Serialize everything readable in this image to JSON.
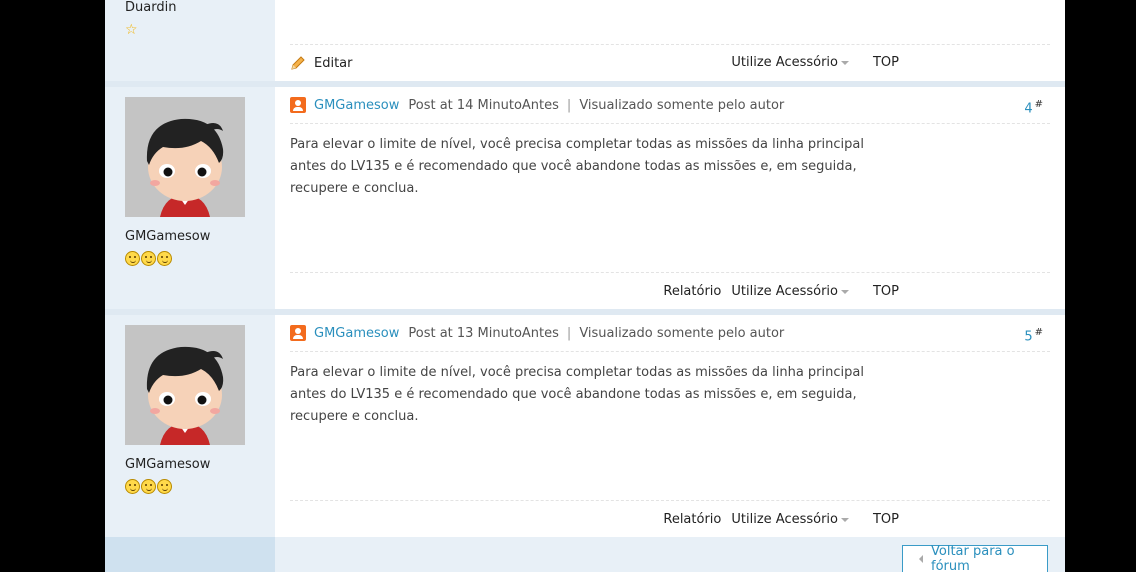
{
  "post_prev": {
    "username": "Duardin",
    "edit_label": "Editar",
    "utilize_label": "Utilize Acessório",
    "top_label": "TOP"
  },
  "posts": [
    {
      "username": "GMGamesow",
      "author": "GMGamesow",
      "posted": "Post at 14 MinutoAntes",
      "view_only_author": "Visualizado somente pelo autor",
      "floor": "4",
      "floor_mark": "#",
      "content": "Para elevar o limite de nível, você precisa completar todas as missões da linha principal antes do LV135 e é recomendado que você abandone todas as missões e, em seguida, recupere e conclua.",
      "report_label": "Relatório",
      "utilize_label": "Utilize Acessório",
      "top_label": "TOP"
    },
    {
      "username": "GMGamesow",
      "author": "GMGamesow",
      "posted": "Post at 13 MinutoAntes",
      "view_only_author": "Visualizado somente pelo autor",
      "floor": "5",
      "floor_mark": "#",
      "content": "Para elevar o limite de nível, você precisa completar todas as missões da linha principal antes do LV135 e é recomendado que você abandone todas as missões e, em seguida, recupere e conclua.",
      "report_label": "Relatório",
      "utilize_label": "Utilize Acessório",
      "top_label": "TOP"
    }
  ],
  "footer": {
    "back_label": "Voltar para o fórum"
  }
}
